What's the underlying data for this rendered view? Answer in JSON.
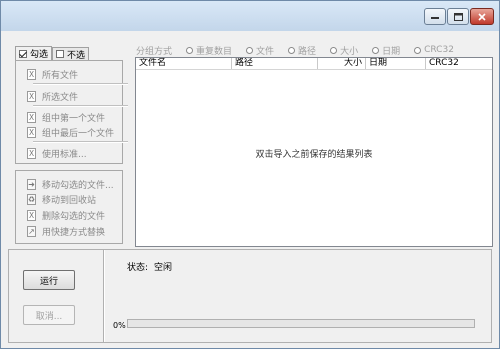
{
  "window": {
    "controls": [
      "minimize-icon",
      "maximize-icon",
      "close-icon"
    ]
  },
  "tabs": [
    {
      "label": "勾选",
      "checked": true
    },
    {
      "label": "不选",
      "checked": false
    }
  ],
  "select_menu": {
    "items": [
      {
        "label": "所有文件",
        "icon": "checkbox-x-icon"
      },
      {
        "label": "所选文件",
        "icon": "checkbox-x-icon"
      },
      {
        "label": "组中第一个文件",
        "icon": "checkbox-x-icon"
      },
      {
        "label": "组中最后一个文件",
        "icon": "checkbox-x-icon"
      },
      {
        "label": "使用标准...",
        "icon": "checkbox-x-icon"
      }
    ]
  },
  "action_menu": {
    "items": [
      {
        "label": "移动勾选的文件...",
        "icon": "move-file-icon"
      },
      {
        "label": "移动到回收站",
        "icon": "recycle-bin-icon"
      },
      {
        "label": "删除勾选的文件",
        "icon": "delete-file-icon"
      },
      {
        "label": "用快捷方式替换",
        "icon": "shortcut-icon"
      }
    ]
  },
  "sort_options": {
    "items": [
      {
        "label": "分组方式",
        "type": "text"
      },
      {
        "label": "重复数目",
        "type": "radio"
      },
      {
        "label": "文件",
        "type": "radio"
      },
      {
        "label": "路径",
        "type": "radio"
      },
      {
        "label": "大小",
        "type": "radio"
      },
      {
        "label": "日期",
        "type": "radio"
      },
      {
        "label": "CRC32",
        "type": "radio"
      }
    ]
  },
  "results": {
    "columns": [
      "文件名",
      "路径",
      "大小",
      "日期",
      "CRC32"
    ],
    "empty_hint": "双击导入之前保存的结果列表"
  },
  "buttons": {
    "run": "运行",
    "cancel": "取消..."
  },
  "status": {
    "label": "状态:",
    "value": "空闲"
  },
  "progress": {
    "value": 0,
    "text": "0%"
  }
}
